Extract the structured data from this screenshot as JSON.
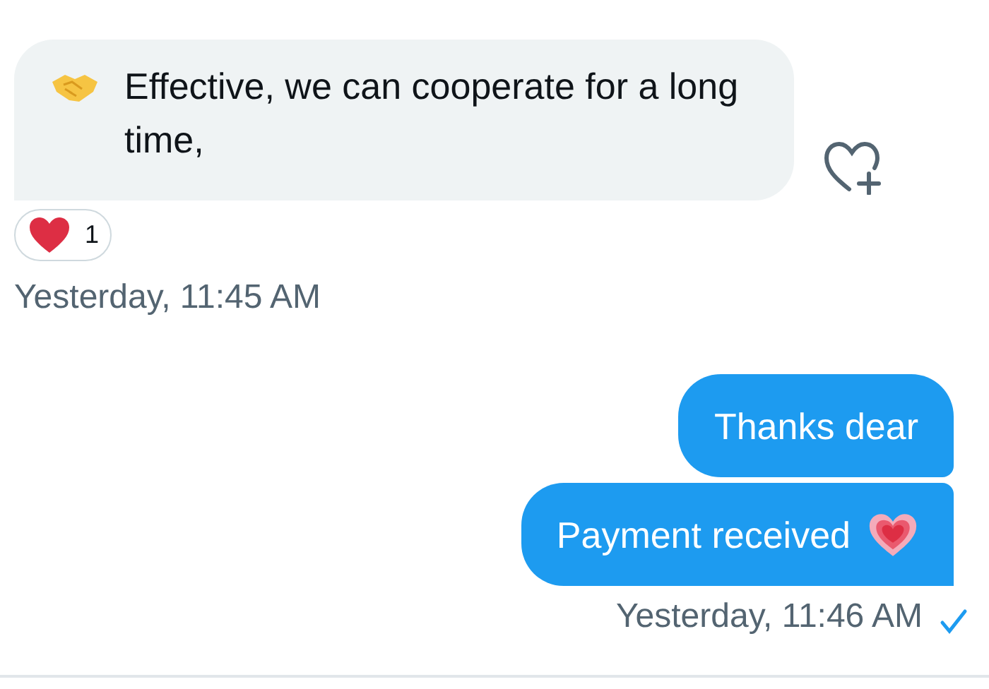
{
  "conversation": [
    {
      "kind": "received",
      "messages": [
        {
          "kind": "handshake",
          "text": "Effective, we can cooperate for a long time,",
          "reactions": [
            {
              "kind": "heart",
              "count": "1"
            }
          ]
        }
      ],
      "timestamp": "Yesterday, 11:45 AM"
    },
    {
      "kind": "sent",
      "messages": [
        {
          "kind": "plain",
          "text": "Thanks dear"
        },
        {
          "kind": "heart",
          "text": "Payment received"
        }
      ],
      "timestamp": "Yesterday, 11:46 AM",
      "delivered": true
    }
  ]
}
